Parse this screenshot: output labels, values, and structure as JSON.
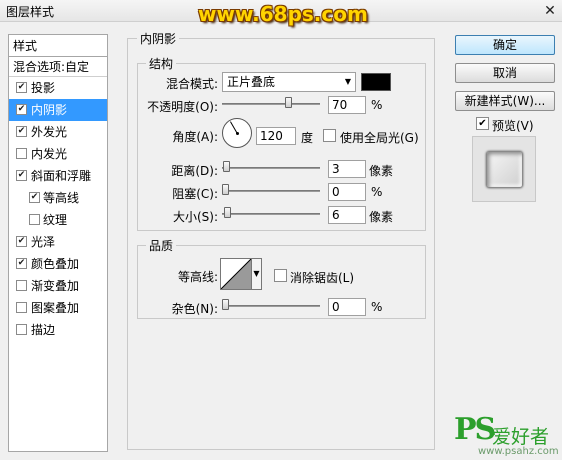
{
  "window": {
    "title": "图层样式",
    "watermark": "www.68ps.com",
    "close": "✕"
  },
  "sidebar": {
    "header": "样式",
    "blend_options": "混合选项:自定",
    "items": [
      {
        "label": "投影",
        "checked": true
      },
      {
        "label": "内阴影",
        "checked": true,
        "selected": true
      },
      {
        "label": "外发光",
        "checked": true
      },
      {
        "label": "内发光",
        "checked": false
      },
      {
        "label": "斜面和浮雕",
        "checked": true
      },
      {
        "label": "等高线",
        "checked": true,
        "indent": true
      },
      {
        "label": "纹理",
        "checked": false,
        "indent": true
      },
      {
        "label": "光泽",
        "checked": true
      },
      {
        "label": "颜色叠加",
        "checked": true
      },
      {
        "label": "渐变叠加",
        "checked": false
      },
      {
        "label": "图案叠加",
        "checked": false
      },
      {
        "label": "描边",
        "checked": false
      }
    ]
  },
  "panel": {
    "title": "内阴影",
    "structure": {
      "title": "结构",
      "blend_mode_label": "混合模式:",
      "blend_mode_value": "正片叠底",
      "shadow_color": "#000000",
      "opacity_label": "不透明度(O):",
      "opacity_value": "70",
      "opacity_unit": "%",
      "angle_label": "角度(A):",
      "angle_value": "120",
      "angle_unit": "度",
      "global_light_label": "使用全局光(G)",
      "global_light_checked": false,
      "distance_label": "距离(D):",
      "distance_value": "3",
      "distance_unit": "像素",
      "choke_label": "阻塞(C):",
      "choke_value": "0",
      "choke_unit": "%",
      "size_label": "大小(S):",
      "size_value": "6",
      "size_unit": "像素"
    },
    "quality": {
      "title": "品质",
      "contour_label": "等高线:",
      "antialias_label": "消除锯齿(L)",
      "antialias_checked": false,
      "noise_label": "杂色(N):",
      "noise_value": "0",
      "noise_unit": "%"
    }
  },
  "buttons": {
    "ok": "确定",
    "cancel": "取消",
    "new_style": "新建样式(W)...",
    "preview_label": "预览(V)",
    "preview_checked": true
  },
  "logo": {
    "ps": "PS",
    "text": "爱好者",
    "url": "www.psahz.com"
  }
}
